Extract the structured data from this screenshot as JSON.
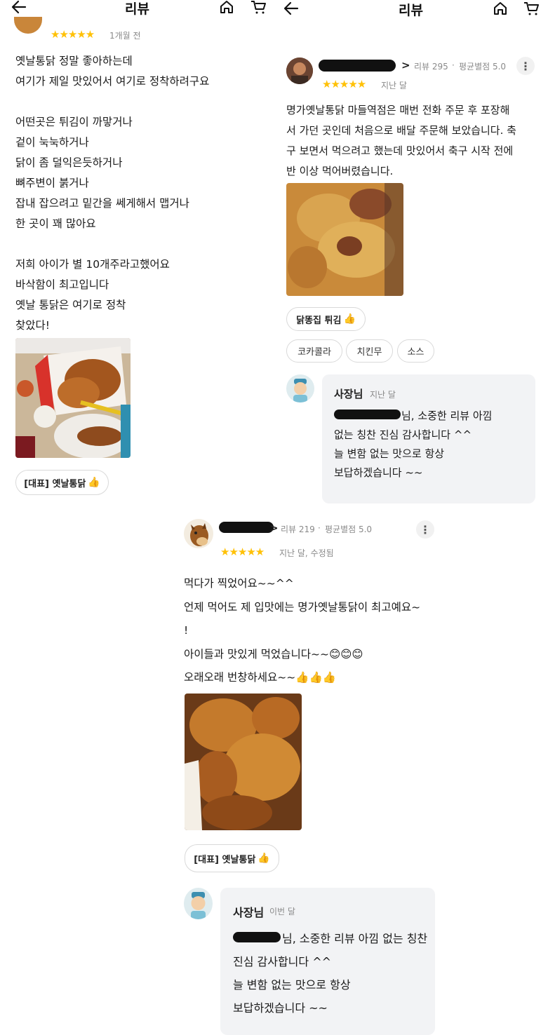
{
  "header_left": {
    "title": "리뷰"
  },
  "header_right": {
    "title": "리뷰"
  },
  "review1": {
    "stars": "★★★★★",
    "date": "1개월 전",
    "text": "옛날통닭 정말 좋아하는데\n여기가 제일 맛있어서 여기로 정착하려구요\n\n어떤곳은 튀김이 까맣거나\n겉이 눅눅하거나\n닭이 좀 덜익은듯하거나\n뼈주변이 붉거나\n잡내 잡으려고 밑간을  쎄게해서 맵거나\n한 곳이 꽤 많아요\n\n저희 아이가 별 10개주라고했어요\n바삭함이  최고입니다\n옛날 통닭은 여기로 정착\n찾았다!",
    "menu_chip": "[대표] 옛날통닭"
  },
  "review2": {
    "chevron": ">",
    "review_count": "리뷰 295",
    "avg_rating": "평균별점 5.0",
    "stars": "★★★★★",
    "date": "지난 달",
    "text": "명가옛날통닭 마들역점은 매번 전화 주문 후 포장해\n서 가던 곳인데 처음으로 배달 주문해 보았습니다. 축\n구 보면서 먹으려고 했는데 맛있어서 축구 시작 전에\n반 이상 먹어버렸습니다.",
    "menu_chip": "닭똥집 튀김",
    "extra_chips": [
      "코카콜라",
      "치킨무",
      "소스"
    ],
    "reply": {
      "name": "사장님",
      "date": "지난 달",
      "text": "님, 소중한 리뷰 아낌\n없는 칭찬  진심 감사합니다 ^^\n늘 변함 없는 맛으로 항상\n보답하겠습니다 ~~"
    }
  },
  "review3": {
    "chevron": ">",
    "review_count": "리뷰 219",
    "avg_rating": "평균별점 5.0",
    "stars": "★★★★★",
    "date": "지난 달, 수정됨",
    "text": "먹다가 찍었어요~~^^\n언제 먹어도 제 입맛에는 명가옛날통닭이 최고예요~\n!\n아이들과 맛있게 먹었습니다~~😊😊😊\n오래오래 번창하세요~~👍👍👍",
    "menu_chip": "[대표] 옛날통닭",
    "reply": {
      "name": "사장님",
      "date": "이번 달",
      "text": "님, 소중한 리뷰 아낌 없는 칭찬\n진심 감사합니다 ^^\n늘 변함 없는 맛으로 항상\n보답하겠습니다 ~~"
    }
  },
  "icons": {
    "back": "arrow-left-icon",
    "home": "home-icon",
    "cart": "cart-icon",
    "thumb": "👍",
    "more": "⋮"
  },
  "colors": {
    "star": "#ffc107",
    "thumb": "#3aa0d8",
    "reply_bg": "#f2f3f5"
  }
}
